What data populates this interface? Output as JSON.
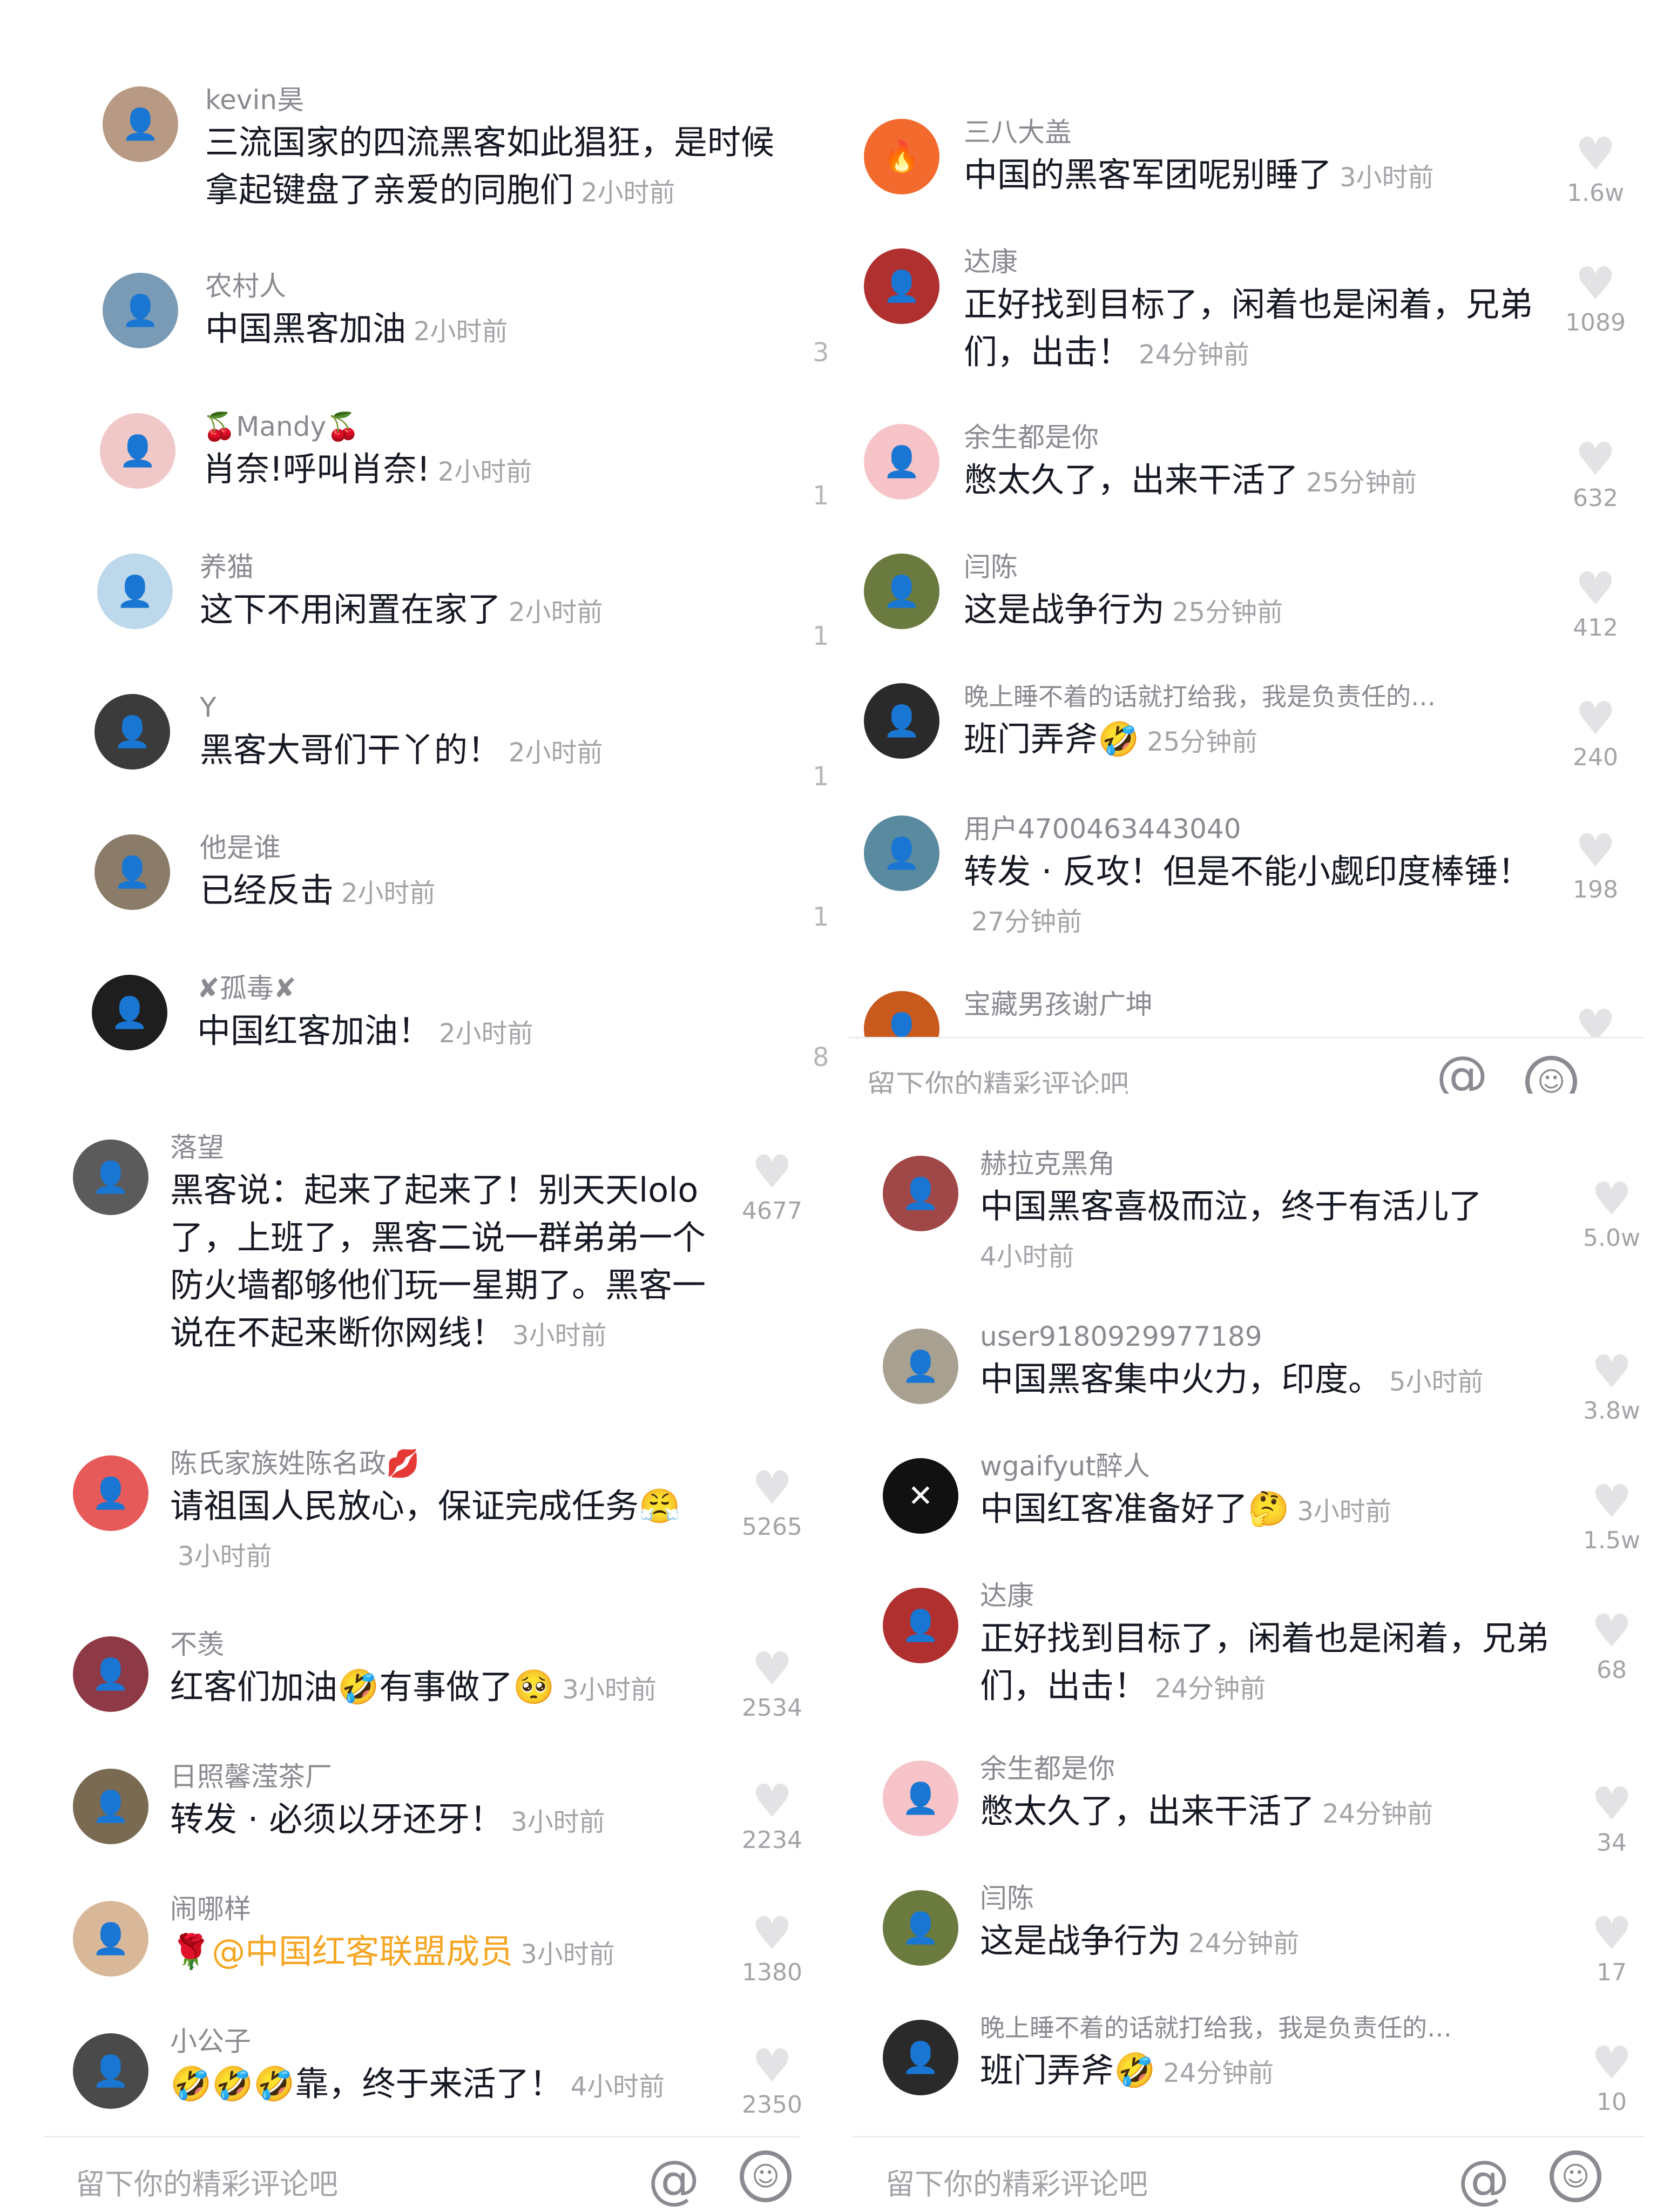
{
  "top_left": {
    "comments": [
      {
        "user": "kevin昊",
        "text": "三流国家的四流黑客如此猖狂，是时候拿起键盘了亲爱的同胞们",
        "time": "2小时前"
      },
      {
        "user": "农村人",
        "text": "中国黑客加油",
        "time": "2小时前"
      },
      {
        "user": "🍒Mandy🍒",
        "text": "肖奈!呼叫肖奈!",
        "time": "2小时前"
      },
      {
        "user": "养猫",
        "text": "这下不用闲置在家了",
        "time": "2小时前"
      },
      {
        "user": "Y",
        "text": "黑客大哥们干丫的！",
        "time": "2小时前"
      },
      {
        "user": "他是谁",
        "text": "已经反击",
        "time": "2小时前"
      },
      {
        "user": "✘孤毒✘",
        "text": "中国红客加油！",
        "time": "2小时前"
      }
    ],
    "edge_marks": [
      "3",
      "1",
      "1",
      "1",
      "1",
      "8"
    ]
  },
  "top_right": {
    "comments": [
      {
        "user": "三八大盖",
        "text": "中国的黑客军团呢别睡了",
        "time": "3小时前",
        "likes": "1.6w"
      },
      {
        "user": "达康",
        "text": "正好找到目标了，闲着也是闲着，兄弟们，出击！",
        "time": "24分钟前",
        "likes": "1089"
      },
      {
        "user": "余生都是你",
        "text": "憋太久了，出来干活了",
        "time": "25分钟前",
        "likes": "632"
      },
      {
        "user": "闫陈",
        "text": "这是战争行为",
        "time": "25分钟前",
        "likes": "412"
      },
      {
        "user": "晚上睡不着的话就打给我，我是负责任的…",
        "text": "班门弄斧🤣",
        "time": "25分钟前",
        "likes": "240"
      },
      {
        "user": "用户4700463443040",
        "text": "转发 · 反攻！但是不能小觑印度棒锤！",
        "time": "27分钟前",
        "likes": "198"
      },
      {
        "user": "宝藏男孩谢广坤",
        "text": "",
        "time": "",
        "likes": ""
      }
    ],
    "input_placeholder": "留下你的精彩评论吧"
  },
  "bottom_left": {
    "comments": [
      {
        "user": "落望",
        "text": "黑客说：起来了起来了！别天天lolo了，上班了，黑客二说一群弟弟一个防火墙都够他们玩一星期了。黑客一说在不起来断你网线！",
        "time": "3小时前",
        "likes": "4677"
      },
      {
        "user": "陈氏家族姓陈名政💋",
        "text": "请祖国人民放心，保证完成任务😤",
        "time": "3小时前",
        "likes": "5265"
      },
      {
        "user": "不羡",
        "text": "红客们加油🤣有事做了🥺",
        "time": "3小时前",
        "likes": "2534"
      },
      {
        "user": "日照馨滢茶厂",
        "text": "转发 · 必须以牙还牙！",
        "time": "3小时前",
        "likes": "2234"
      },
      {
        "user": "闹哪样",
        "text": "🌹@中国红客联盟成员",
        "time": "3小时前",
        "likes": "1380"
      },
      {
        "user": "小公子",
        "text": "🤣🤣🤣靠，终于来活了！",
        "time": "4小时前",
        "likes": "2350"
      }
    ],
    "input_placeholder": "留下你的精彩评论吧"
  },
  "bottom_right": {
    "comments": [
      {
        "user": "赫拉克黑角",
        "text": "中国黑客喜极而泣，终于有活儿了",
        "time": "4小时前",
        "likes": "5.0w"
      },
      {
        "user": "user9180929977189",
        "text": "中国黑客集中火力，印度。",
        "time": "5小时前",
        "likes": "3.8w"
      },
      {
        "user": "wgaifyut醉人",
        "text": "中国红客准备好了🤔",
        "time": "3小时前",
        "likes": "1.5w"
      },
      {
        "user": "达康",
        "text": "正好找到目标了，闲着也是闲着，兄弟们，出击！",
        "time": "24分钟前",
        "likes": "68"
      },
      {
        "user": "余生都是你",
        "text": "憋太久了，出来干活了",
        "time": "24分钟前",
        "likes": "34"
      },
      {
        "user": "闫陈",
        "text": "这是战争行为",
        "time": "24分钟前",
        "likes": "17"
      },
      {
        "user": "晚上睡不着的话就打给我，我是负责任的…",
        "text": "班门弄斧🤣",
        "time": "24分钟前",
        "likes": "10"
      }
    ],
    "input_placeholder": "留下你的精彩评论吧"
  },
  "icons": {
    "like": "heart-icon",
    "mention": "at-icon",
    "emoji": "smile-icon"
  },
  "colors": {
    "text": "#161823",
    "username": "#8a8b91",
    "meta": "#a3a4a8",
    "heart": "#e3e3e6",
    "mention": "#f5a623"
  }
}
